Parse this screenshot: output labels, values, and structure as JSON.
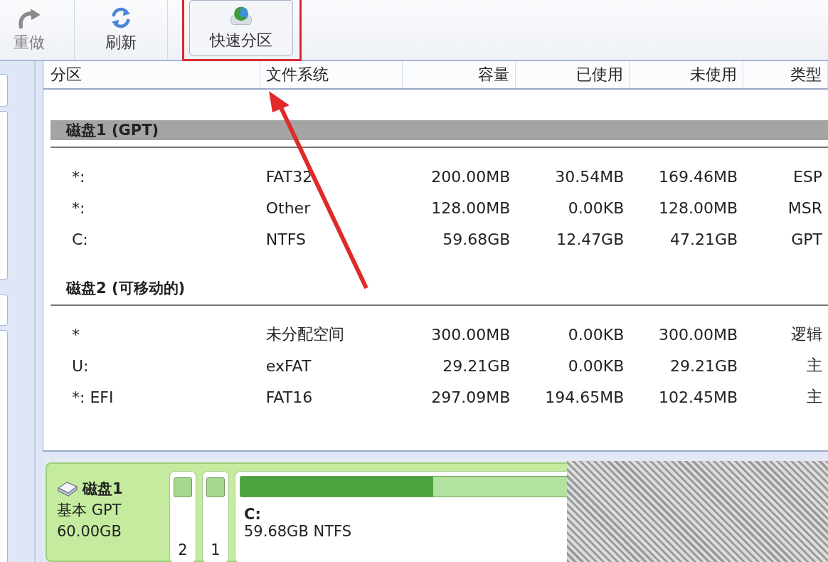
{
  "toolbar": {
    "buttons": [
      {
        "label": "重做",
        "kind": "redo",
        "disabled": true,
        "selected": false
      },
      {
        "label": "刷新",
        "kind": "refresh",
        "disabled": false,
        "selected": false
      },
      {
        "label": "快速分区",
        "kind": "quick-partition",
        "disabled": false,
        "selected": true
      }
    ]
  },
  "table": {
    "columns": [
      "分区",
      "文件系统",
      "容量",
      "已使用",
      "未使用",
      "类型"
    ],
    "groups": [
      {
        "title": "磁盘1 (GPT)",
        "selected": true,
        "rows": [
          {
            "partition": "*:",
            "filesystem": "FAT32",
            "capacity": "200.00MB",
            "used": "30.54MB",
            "free": "169.46MB",
            "type": "ESP"
          },
          {
            "partition": "*:",
            "filesystem": "Other",
            "capacity": "128.00MB",
            "used": "0.00KB",
            "free": "128.00MB",
            "type": "MSR"
          },
          {
            "partition": "C:",
            "filesystem": "NTFS",
            "capacity": "59.68GB",
            "used": "12.47GB",
            "free": "47.21GB",
            "type": "GPT"
          }
        ]
      },
      {
        "title": "磁盘2 (可移动的)",
        "selected": false,
        "rows": [
          {
            "partition": "*",
            "filesystem": "未分配空间",
            "capacity": "300.00MB",
            "used": "0.00KB",
            "free": "300.00MB",
            "type": "逻辑"
          },
          {
            "partition": "U:",
            "filesystem": "exFAT",
            "capacity": "29.21GB",
            "used": "0.00KB",
            "free": "29.21GB",
            "type": "主"
          },
          {
            "partition": "*: EFI",
            "filesystem": "FAT16",
            "capacity": "297.09MB",
            "used": "194.65MB",
            "free": "102.45MB",
            "type": "主"
          }
        ]
      }
    ]
  },
  "disk_map": {
    "name": "磁盘1",
    "style": "基本 GPT",
    "size": "60.00GB",
    "small_partitions": [
      {
        "label": "2"
      },
      {
        "label": "1"
      }
    ],
    "main_partition": {
      "name": "C:",
      "info": "59.68GB NTFS",
      "level": 0.59
    }
  }
}
